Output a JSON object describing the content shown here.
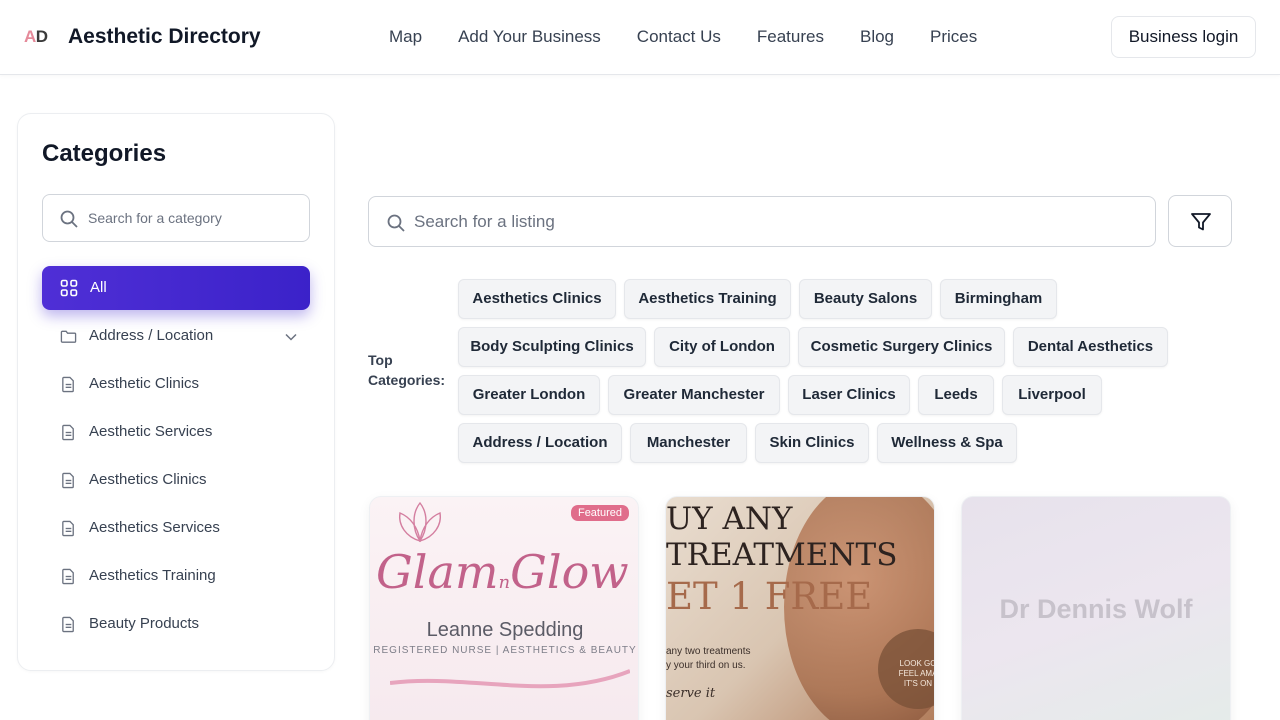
{
  "header": {
    "logo_a": "A",
    "logo_d": "D",
    "brand": "Aesthetic Directory",
    "nav": [
      "Map",
      "Add Your Business",
      "Contact Us",
      "Features",
      "Blog",
      "Prices"
    ],
    "login": "Business login"
  },
  "sidebar": {
    "title": "Categories",
    "search_placeholder": "Search for a category",
    "all_label": "All",
    "items": [
      {
        "label": "Address / Location",
        "icon": "folder-icon",
        "expandable": true
      },
      {
        "label": "Aesthetic Clinics",
        "icon": "file-icon"
      },
      {
        "label": "Aesthetic Services",
        "icon": "file-icon"
      },
      {
        "label": "Aesthetics Clinics",
        "icon": "file-icon"
      },
      {
        "label": "Aesthetics Services",
        "icon": "file-icon"
      },
      {
        "label": "Aesthetics Training",
        "icon": "file-icon"
      },
      {
        "label": "Beauty Products",
        "icon": "file-icon"
      }
    ]
  },
  "main": {
    "search_placeholder": "Search for a listing",
    "top_categories_label_1": "Top",
    "top_categories_label_2": "Categories:",
    "chips": [
      "Aesthetics Clinics",
      "Aesthetics Training",
      "Beauty Salons",
      "Birmingham",
      "Body Sculpting Clinics",
      "City of London",
      "Cosmetic Surgery Clinics",
      "Dental Aesthetics",
      "Greater London",
      "Greater Manchester",
      "Laser Clinics",
      "Leeds",
      "Liverpool",
      "Address / Location",
      "Manchester",
      "Skin Clinics",
      "Wellness & Spa"
    ]
  },
  "cards": {
    "card1": {
      "badge": "Featured",
      "title": "Glam",
      "title_n": "n",
      "title_end": "Glow",
      "name": "Leanne Spedding",
      "subtitle": "REGISTERED NURSE | AESTHETICS & BEAUTY"
    },
    "card2": {
      "line1": "UY ANY",
      "line2": "TREATMENTS",
      "line3": "ET 1 FREE",
      "small1": "any two treatments",
      "small2": "y your third on us.",
      "small3": "serve it",
      "circle1": "LOOK GO",
      "circle2": "FEEL AMA",
      "circle3": "IT'S ON"
    },
    "card3": {
      "name": "Dr Dennis Wolf"
    }
  },
  "colors": {
    "accent": "#4329ce",
    "logo_pink": "#e58a9a",
    "featured_badge": "#e06d8b"
  }
}
